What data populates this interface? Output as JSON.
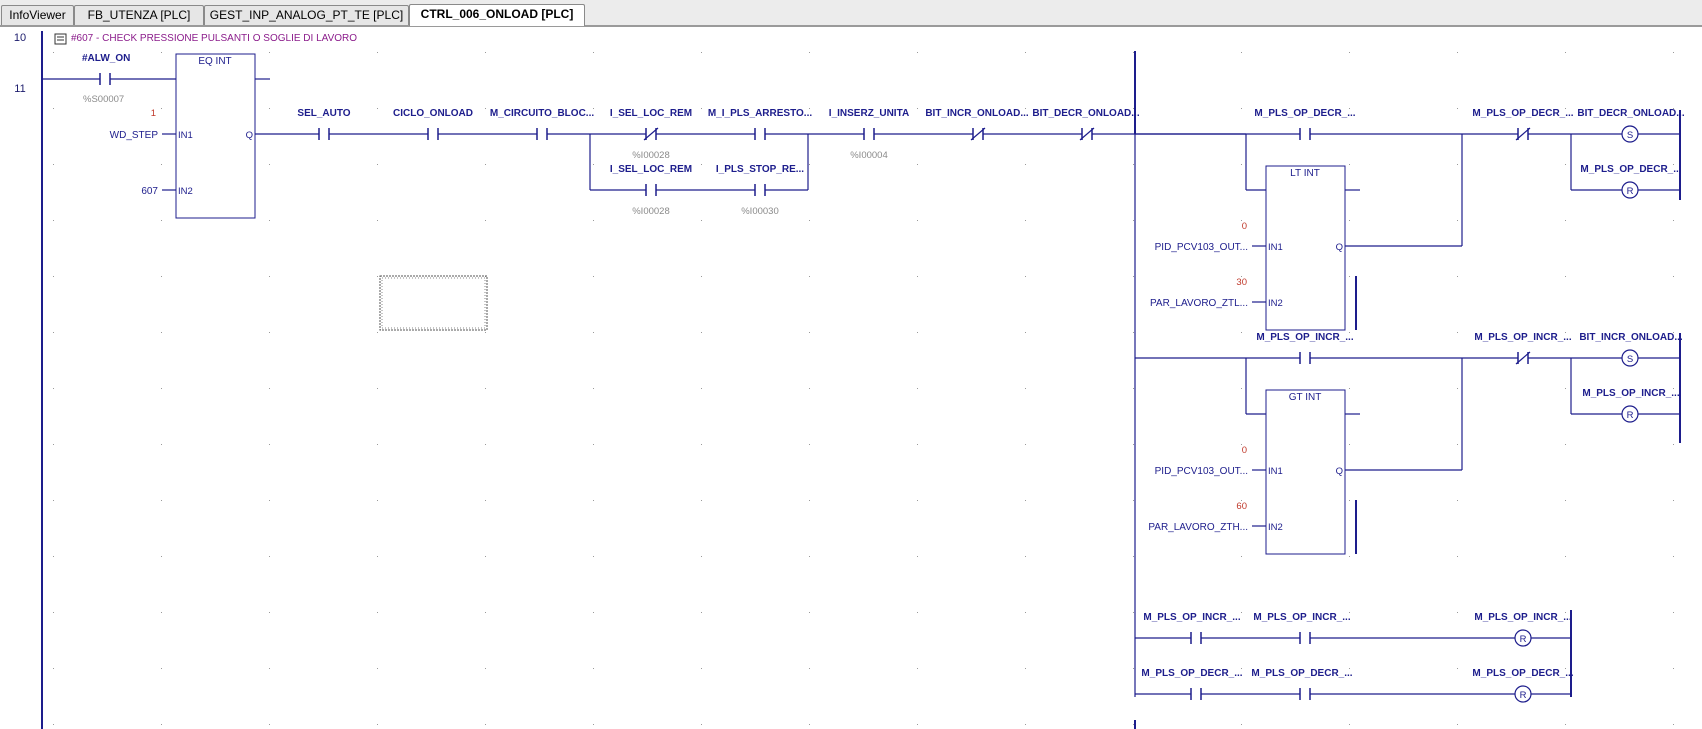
{
  "tabs": [
    {
      "label": "InfoViewer",
      "active": false
    },
    {
      "label": "FB_UTENZA [PLC]",
      "active": false
    },
    {
      "label": "GEST_INP_ANALOG_PT_TE [PLC]",
      "active": false
    },
    {
      "label": "CTRL_006_ONLOAD [PLC]",
      "active": true
    }
  ],
  "rungs": [
    {
      "number": "10"
    },
    {
      "number": "11"
    }
  ],
  "comment": "#607 - CHECK PRESSIONE PULSANTI O SOGLIE DI LAVORO",
  "contacts": {
    "alw_on": {
      "label": "#ALW_ON",
      "addr": "%S00007"
    },
    "sel_auto": {
      "label": "SEL_AUTO"
    },
    "ciclo_onload": {
      "label": "CICLO_ONLOAD"
    },
    "m_circuito": {
      "label": "M_CIRCUITO_BLOC..."
    },
    "sel_loc_rem_1": {
      "label": "I_SEL_LOC_REM",
      "addr": "%I00028"
    },
    "m_i_pls_arresto": {
      "label": "M_I_PLS_ARRESTO..."
    },
    "sel_loc_rem_2": {
      "label": "I_SEL_LOC_REM",
      "addr": "%I00028"
    },
    "i_pls_stop": {
      "label": "I_PLS_STOP_RE...",
      "addr": "%I00030"
    },
    "i_inserz": {
      "label": "I_INSERZ_UNITA",
      "addr": "%I00004"
    },
    "bit_incr_nc": {
      "label": "BIT_INCR_ONLOAD..."
    },
    "bit_decr_nc": {
      "label": "BIT_DECR_ONLOAD..."
    },
    "m_pls_op_decr_a": {
      "label": "M_PLS_OP_DECR_..."
    },
    "m_pls_op_decr_b": {
      "label": "M_PLS_OP_DECR_..."
    },
    "m_pls_op_incr_a": {
      "label": "M_PLS_OP_INCR_..."
    },
    "m_pls_op_incr_b": {
      "label": "M_PLS_OP_INCR_..."
    },
    "bottom_incr_1": {
      "label": "M_PLS_OP_INCR_..."
    },
    "bottom_incr_2": {
      "label": "M_PLS_OP_INCR_..."
    },
    "bottom_decr_1": {
      "label": "M_PLS_OP_DECR_..."
    },
    "bottom_decr_2": {
      "label": "M_PLS_OP_DECR_..."
    }
  },
  "coils": {
    "set_decr": {
      "label": "BIT_DECR_ONLOAD...",
      "symbol": "S"
    },
    "reset_decr": {
      "label": "M_PLS_OP_DECR_...",
      "symbol": "R"
    },
    "set_incr": {
      "label": "BIT_INCR_ONLOAD...",
      "symbol": "S"
    },
    "reset_incr": {
      "label": "M_PLS_OP_INCR_...",
      "symbol": "R"
    },
    "reset_bottom_incr": {
      "label": "M_PLS_OP_INCR_...",
      "symbol": "R"
    },
    "reset_bottom_decr": {
      "label": "M_PLS_OP_DECR_...",
      "symbol": "R"
    }
  },
  "blocks": {
    "eq": {
      "title": "EQ INT",
      "in1_label": "IN1",
      "in2_label": "IN2",
      "q_label": "Q",
      "in1_const": "1",
      "in1_var": "WD_STEP",
      "in2_const": "607"
    },
    "lt": {
      "title": "LT INT",
      "in1_label": "IN1",
      "in2_label": "IN2",
      "q_label": "Q",
      "in1_const": "0",
      "in1_var": "PID_PCV103_OUT...",
      "in2_const": "30",
      "in2_var": "PAR_LAVORO_ZTL..."
    },
    "gt": {
      "title": "GT INT",
      "in1_label": "IN1",
      "in2_label": "IN2",
      "q_label": "Q",
      "in1_const": "0",
      "in1_var": "PID_PCV103_OUT...",
      "in2_const": "60",
      "in2_var": "PAR_LAVORO_ZTH..."
    }
  },
  "colors": {
    "wire": "#1d1d8c",
    "label": "#1d1d8c",
    "address": "#8a8a8a",
    "constant": "#c0392b",
    "comment": "#8b1c8b"
  }
}
